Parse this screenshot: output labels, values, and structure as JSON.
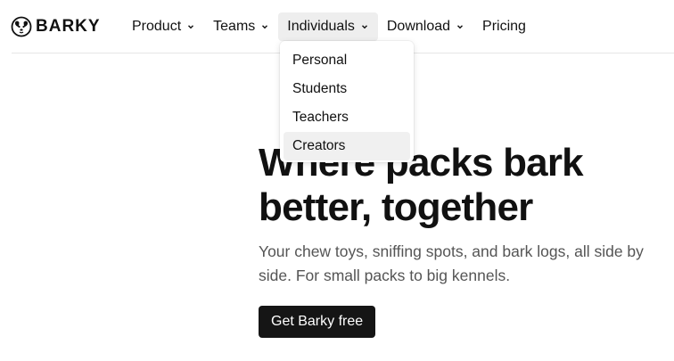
{
  "brand": {
    "name": "BARKY",
    "logo_icon": "dog-face-icon"
  },
  "nav": {
    "items": [
      {
        "label": "Product",
        "has_dropdown": true,
        "active": false
      },
      {
        "label": "Teams",
        "has_dropdown": true,
        "active": false
      },
      {
        "label": "Individuals",
        "has_dropdown": true,
        "active": true
      },
      {
        "label": "Download",
        "has_dropdown": true,
        "active": false
      },
      {
        "label": "Pricing",
        "has_dropdown": false,
        "active": false
      }
    ]
  },
  "dropdown": {
    "parent": "Individuals",
    "items": [
      {
        "label": "Personal"
      },
      {
        "label": "Students"
      },
      {
        "label": "Teachers"
      },
      {
        "label": "Creators",
        "hovered": true
      }
    ]
  },
  "hero": {
    "title_line1": "Where packs bark",
    "title_line2": "better, together",
    "subtitle": "Your chew toys, sniffing spots, and bark logs, all side by side. For small packs to big kennels.",
    "cta_label": "Get Barky free"
  },
  "colors": {
    "text": "#111111",
    "muted": "#555555",
    "active_bg": "#eeeeee",
    "hover_bg": "#f0f0f0",
    "cta_bg": "#151515",
    "divider": "#e6e6e6"
  }
}
